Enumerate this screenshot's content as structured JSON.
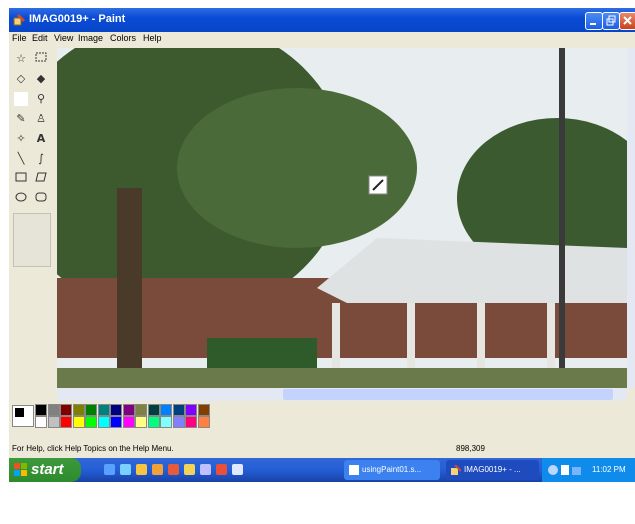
{
  "window": {
    "title": "IMAG0019+ - Paint"
  },
  "menu": [
    "File",
    "Edit",
    "View",
    "Image",
    "Colors",
    "Help"
  ],
  "tools": [
    "free-select",
    "select",
    "eraser",
    "fill",
    "pick-color",
    "magnifier",
    "pencil",
    "brush",
    "airbrush",
    "text",
    "line",
    "curve",
    "rectangle",
    "polygon",
    "ellipse",
    "rounded-rectangle"
  ],
  "palette": {
    "row1": [
      "#000000",
      "#808080",
      "#800000",
      "#808000",
      "#008000",
      "#008080",
      "#000080",
      "#800080",
      "#808040",
      "#004040",
      "#0080ff",
      "#004080",
      "#8000ff",
      "#804000"
    ],
    "row2": [
      "#ffffff",
      "#c0c0c0",
      "#ff0000",
      "#ffff00",
      "#00ff00",
      "#00ffff",
      "#0000ff",
      "#ff00ff",
      "#ffff80",
      "#00ff80",
      "#80ffff",
      "#8080ff",
      "#ff0080",
      "#ff8040"
    ]
  },
  "status": {
    "help": "For Help, click Help Topics on the Help Menu.",
    "coords": "898,309"
  },
  "taskbar": {
    "start_label": "start",
    "tasks": [
      "usingPaint01.s...",
      "IMAG0019+ - ..."
    ],
    "clock": "11:02 PM"
  }
}
